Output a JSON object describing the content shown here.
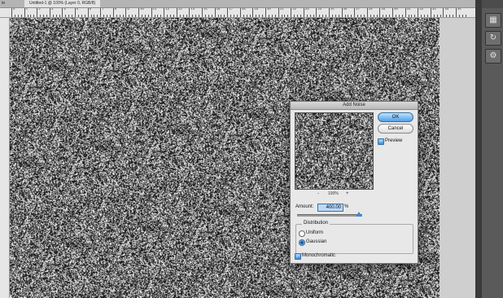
{
  "tabs": {
    "prev_label": "te",
    "active_label": "Untitled-1 @ 100% (Layer 0, RGB/8)"
  },
  "ruler": {
    "labels": [
      "0",
      "1",
      "2",
      "3",
      "4",
      "5",
      "6",
      "7",
      "8",
      "9",
      "10",
      "11",
      "12",
      "13",
      "14",
      "15",
      "16",
      "17",
      "18",
      "19",
      "20",
      "21",
      "22",
      "23",
      "24",
      "25",
      "26",
      "27",
      "28",
      "29",
      "30",
      "31",
      "32",
      "33",
      "34",
      "35"
    ]
  },
  "panel": {
    "icons": [
      "panel-icon-1",
      "panel-icon-2",
      "panel-icon-3"
    ]
  },
  "dialog": {
    "title": "Add Noise",
    "ok_label": "OK",
    "cancel_label": "Cancel",
    "preview_label": "Preview",
    "preview_checked": true,
    "zoom_out": "-",
    "zoom_level": "100%",
    "zoom_in": "+",
    "amount_label": "Amount:",
    "amount_value": "400.00",
    "amount_unit": "%",
    "amount_slider_fraction": 0.95,
    "distribution_label": "Distribution",
    "uniform_label": "Uniform",
    "gaussian_label": "Gaussian",
    "selected_distribution": "Gaussian",
    "monochromatic_label": "Monochromatic",
    "monochromatic_checked": true
  },
  "colors": {
    "accent": "#3f8ad8",
    "panel_bg": "#4c4c4c",
    "noise_dark": "#1a1a1a",
    "noise_light": "#ffffff"
  }
}
